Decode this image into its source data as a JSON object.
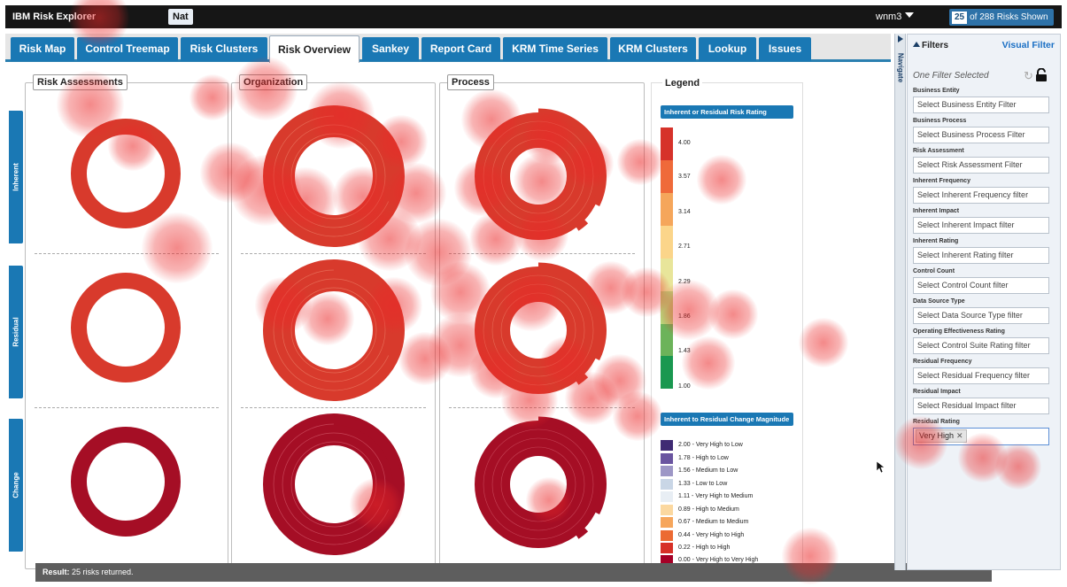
{
  "app": {
    "title": "IBM Risk Explorer",
    "user_badge": "Nat",
    "username": "wnm3",
    "risk_count_number": "25",
    "risk_count_text": "of 288 Risks Shown"
  },
  "tabs": [
    {
      "label": "Risk Map"
    },
    {
      "label": "Control Treemap"
    },
    {
      "label": "Risk Clusters"
    },
    {
      "label": "Risk Overview",
      "active": true
    },
    {
      "label": "Sankey"
    },
    {
      "label": "Report Card"
    },
    {
      "label": "KRM Time Series"
    },
    {
      "label": "KRM Clusters"
    },
    {
      "label": "Lookup"
    },
    {
      "label": "Issues"
    }
  ],
  "row_labels": [
    "Inherent",
    "Residual",
    "Change"
  ],
  "panels": [
    {
      "title": "Risk Assessments"
    },
    {
      "title": "Organization"
    },
    {
      "title": "Process"
    }
  ],
  "result": {
    "label": "Result:",
    "text": "25 risks returned."
  },
  "legend": {
    "title": "Legend",
    "rating_heading": "Inherent or Residual Risk Rating",
    "rating_ticks": [
      "4.00",
      "3.57",
      "3.14",
      "2.71",
      "2.29",
      "1.86",
      "1.43",
      "1.00"
    ],
    "rating_colors": [
      "#d6322a",
      "#ef6a3a",
      "#f5a65b",
      "#fbd58a",
      "#e8e59a",
      "#b7d67a",
      "#6cb35a",
      "#1a9850"
    ],
    "change_heading": "Inherent to Residual Change Magnitude",
    "change_items": [
      {
        "label": "2.00 - Very High to Low",
        "color": "#3f2a73"
      },
      {
        "label": "1.78 - High to Low",
        "color": "#6a55a0"
      },
      {
        "label": "1.56 - Medium to Low",
        "color": "#9d97c6"
      },
      {
        "label": "1.33 - Low to Low",
        "color": "#c9d6e6"
      },
      {
        "label": "1.11 - Very High to Medium",
        "color": "#e8eef4"
      },
      {
        "label": "0.89 - High to Medium",
        "color": "#fbd8a0"
      },
      {
        "label": "0.67 - Medium to Medium",
        "color": "#f6a65c"
      },
      {
        "label": "0.44 - Very High to High",
        "color": "#ec6a33"
      },
      {
        "label": "0.22 - High to High",
        "color": "#d73027"
      },
      {
        "label": "0.00 - Very High to Very High",
        "color": "#a50026"
      }
    ]
  },
  "navigate": {
    "label": "Navigate"
  },
  "filters": {
    "title": "Filters",
    "visual_filter": "Visual Filter",
    "state": "One Filter Selected",
    "items": [
      {
        "label": "Business Entity",
        "placeholder": "Select Business Entity Filter"
      },
      {
        "label": "Business Process",
        "placeholder": "Select Business Process Filter"
      },
      {
        "label": "Risk Assessment",
        "placeholder": "Select Risk Assessment Filter"
      },
      {
        "label": "Inherent Frequency",
        "placeholder": "Select Inherent Frequency filter"
      },
      {
        "label": "Inherent Impact",
        "placeholder": "Select Inherent Impact filter"
      },
      {
        "label": "Inherent Rating",
        "placeholder": "Select Inherent Rating filter"
      },
      {
        "label": "Control Count",
        "placeholder": "Select Control Count filter"
      },
      {
        "label": "Data Source Type",
        "placeholder": "Select Data Source Type filter"
      },
      {
        "label": "Operating Effectiveness Rating",
        "placeholder": "Select Control Suite Rating filter"
      },
      {
        "label": "Residual Frequency",
        "placeholder": "Select Residual Frequency filter"
      },
      {
        "label": "Residual Impact",
        "placeholder": "Select Residual Impact filter"
      }
    ],
    "residual_rating": {
      "label": "Residual Rating",
      "chip": "Very High"
    }
  },
  "colors": {
    "inherent_ring": "#d83a2c",
    "change_ring": "#a50e25",
    "accent": "#1a78b4"
  }
}
